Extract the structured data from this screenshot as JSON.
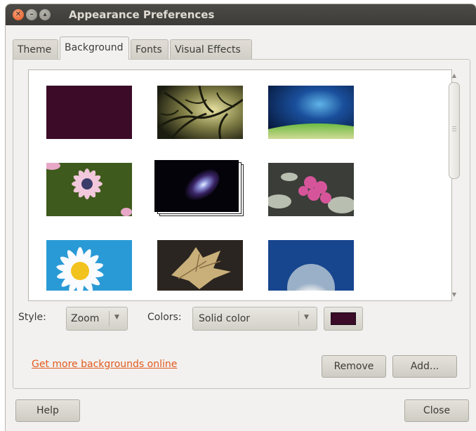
{
  "window": {
    "title": "Appearance Preferences",
    "close_glyph": "✕",
    "min_glyph": "–",
    "max_glyph": "▴"
  },
  "tabs": [
    {
      "label": "Theme"
    },
    {
      "label": "Background"
    },
    {
      "label": "Fonts"
    },
    {
      "label": "Visual Effects"
    }
  ],
  "active_tab": "Background",
  "gallery": {
    "items": [
      {
        "icon": "solid-color-thumbnail",
        "color": "#3b0b28"
      },
      {
        "icon": "tree-branches-thumbnail"
      },
      {
        "icon": "blue-light-road-thumbnail"
      },
      {
        "icon": "pink-daisy-thumbnail"
      },
      {
        "icon": "nebula-thumbnail",
        "selected": true
      },
      {
        "icon": "pink-flower-thumbnail"
      },
      {
        "icon": "white-daisy-thumbnail"
      },
      {
        "icon": "dry-leaf-thumbnail"
      },
      {
        "icon": "dandelion-thumbnail"
      }
    ]
  },
  "style": {
    "label": "Style:",
    "value": "Zoom"
  },
  "colors": {
    "label": "Colors:",
    "value": "Solid color",
    "swatch_color": "#3b0b28"
  },
  "link": {
    "label": "Get more backgrounds online"
  },
  "buttons": {
    "remove": "Remove",
    "add": "Add...",
    "help": "Help",
    "close": "Close"
  },
  "icons": {
    "dropdown_arrow": "▼",
    "scroll_up": "▲",
    "scroll_down": "▼"
  }
}
